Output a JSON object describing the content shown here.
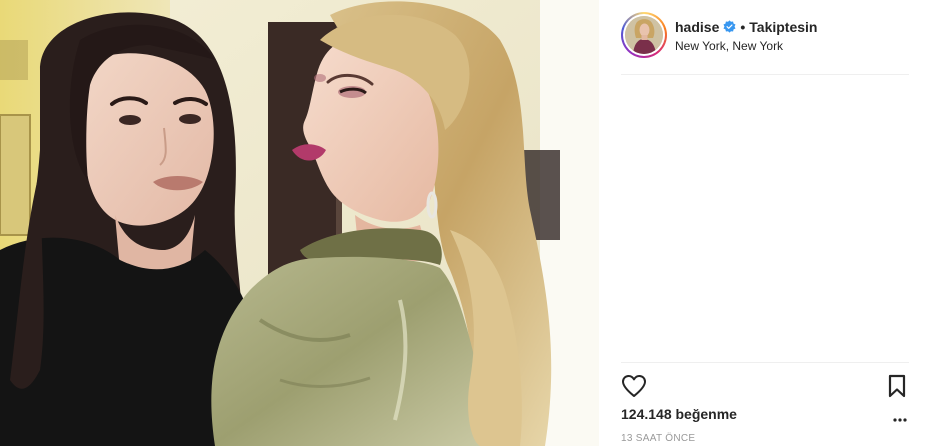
{
  "post": {
    "author": {
      "username": "hadise",
      "verified": true,
      "follow_status": "Takiptesin",
      "separator": "•",
      "location": "New York, New York"
    },
    "likes": {
      "count": "124.148",
      "unit": "beğenme"
    },
    "time_ago": "13 SAAT ÖNCE"
  },
  "icons": {
    "like": "heart-outline-icon",
    "save": "bookmark-outline-icon",
    "more": "more-dots-icon",
    "verified": "verified-badge-icon"
  },
  "colors": {
    "verified_blue": "#3897f0",
    "divider": "#efefef",
    "timestamp_gray": "#999999"
  }
}
